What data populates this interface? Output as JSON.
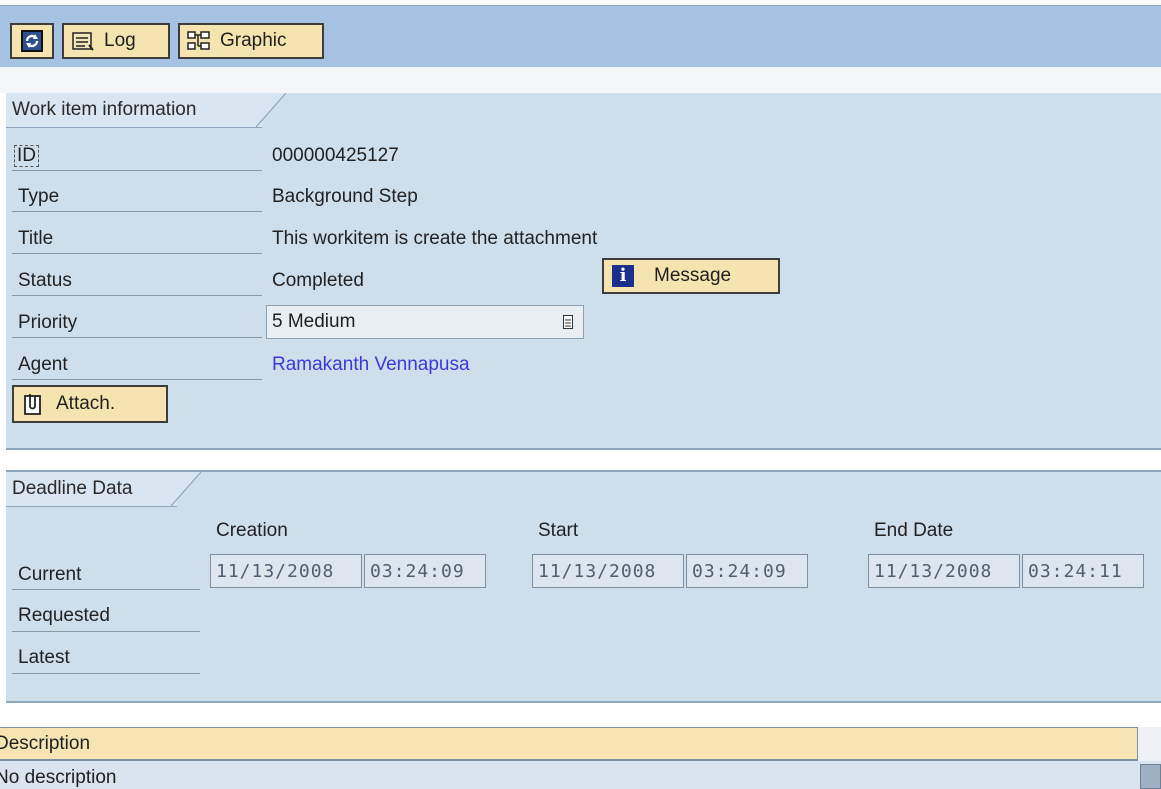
{
  "toolbar": {
    "refresh_icon": "refresh-icon",
    "log_label": "Log",
    "graphic_label": "Graphic"
  },
  "work_item": {
    "tab_title": "Work item information",
    "rows": {
      "id": {
        "label": "ID",
        "value": "000000425127"
      },
      "type": {
        "label": "Type",
        "value": "Background Step"
      },
      "title": {
        "label": "Title",
        "value": "This workitem is create the attachment"
      },
      "status": {
        "label": "Status",
        "value": "Completed"
      },
      "priority": {
        "label": "Priority",
        "value": "5 Medium"
      },
      "agent": {
        "label": "Agent",
        "value": "Ramakanth Vennapusa"
      }
    },
    "message_button": "Message",
    "attach_button": "Attach.",
    "agent_link_color": "#3a3ad8"
  },
  "deadline": {
    "tab_title": "Deadline Data",
    "columns": {
      "creation": "Creation",
      "start": "Start",
      "end": "End Date"
    },
    "rows": {
      "current": "Current",
      "requested": "Requested",
      "latest": "Latest"
    },
    "current": {
      "creation_date": "11/13/2008",
      "creation_time": "03:24:09",
      "start_date": "11/13/2008",
      "start_time": "03:24:09",
      "end_date": "11/13/2008",
      "end_time": "03:24:11"
    }
  },
  "description": {
    "header": "Description",
    "body": "No description"
  }
}
